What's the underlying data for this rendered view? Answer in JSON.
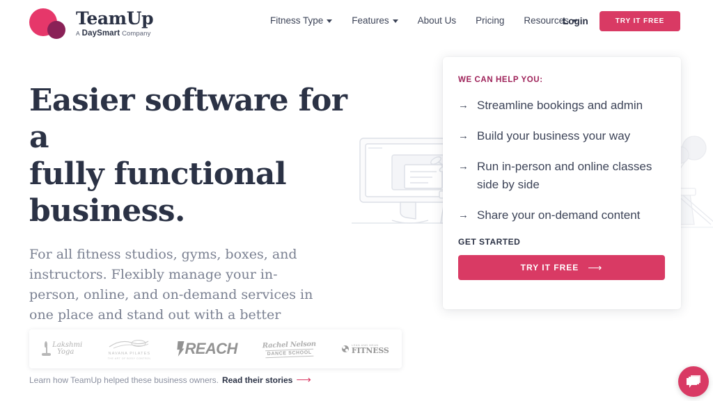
{
  "brand": {
    "name": "TeamUp",
    "tagline_a": "A",
    "tagline_daysmart": "DaySmart",
    "tagline_company": "Company",
    "mark_color_primary": "#E6376A",
    "mark_color_secondary": "#8A2157"
  },
  "nav": {
    "items": [
      {
        "label": "Fitness Type",
        "has_caret": true
      },
      {
        "label": "Features",
        "has_caret": true
      },
      {
        "label": "About Us",
        "has_caret": false
      },
      {
        "label": "Pricing",
        "has_caret": false
      },
      {
        "label": "Resources",
        "has_caret": true
      }
    ],
    "login_label": "Login",
    "cta_label": "TRY IT FREE"
  },
  "hero": {
    "title_line1": "Easier software for a",
    "title_line2": "fully functional",
    "title_line3": "business.",
    "subtitle": "For all fitness studios, gyms, boxes, and instructors. Flexibly manage your in-person, online, and on-demand services in one place and stand out with a better customer experience."
  },
  "help_card": {
    "eyebrow": "WE CAN HELP YOU:",
    "arrow_glyph": "→",
    "items": [
      "Streamline bookings and admin",
      "Build your business your way",
      "Run in-person and online classes side by side",
      "Share your on-demand content"
    ],
    "get_started_label": "GET STARTED",
    "cta_label": "TRY IT FREE",
    "cta_arrow": "⟶",
    "accent_color": "#D93A64",
    "eyebrow_color": "#9E2259"
  },
  "logo_strip": {
    "logos": [
      {
        "name": "lakshmi-yoga",
        "line1": "Lakshmi",
        "line2": "Yoga"
      },
      {
        "name": "navana-pilates",
        "line1": "NAVANA PILATES",
        "line2": "THE ART OF BODY CONTROL"
      },
      {
        "name": "reach",
        "line1": "REACH"
      },
      {
        "name": "dance-school",
        "line1": "Rachel Nelson",
        "line2": "DANCE SCHOOL"
      },
      {
        "name": "lean-and-mean-fitness",
        "line1": "LEAN AND MEAN",
        "line2": "FITNESS"
      }
    ]
  },
  "caption": {
    "text": "Learn how TeamUp helped these business owners.",
    "link_label": "Read their stories",
    "arrow": "⟶"
  },
  "chat": {
    "icon": "chat-bubbles-icon",
    "color": "#D93A64"
  }
}
